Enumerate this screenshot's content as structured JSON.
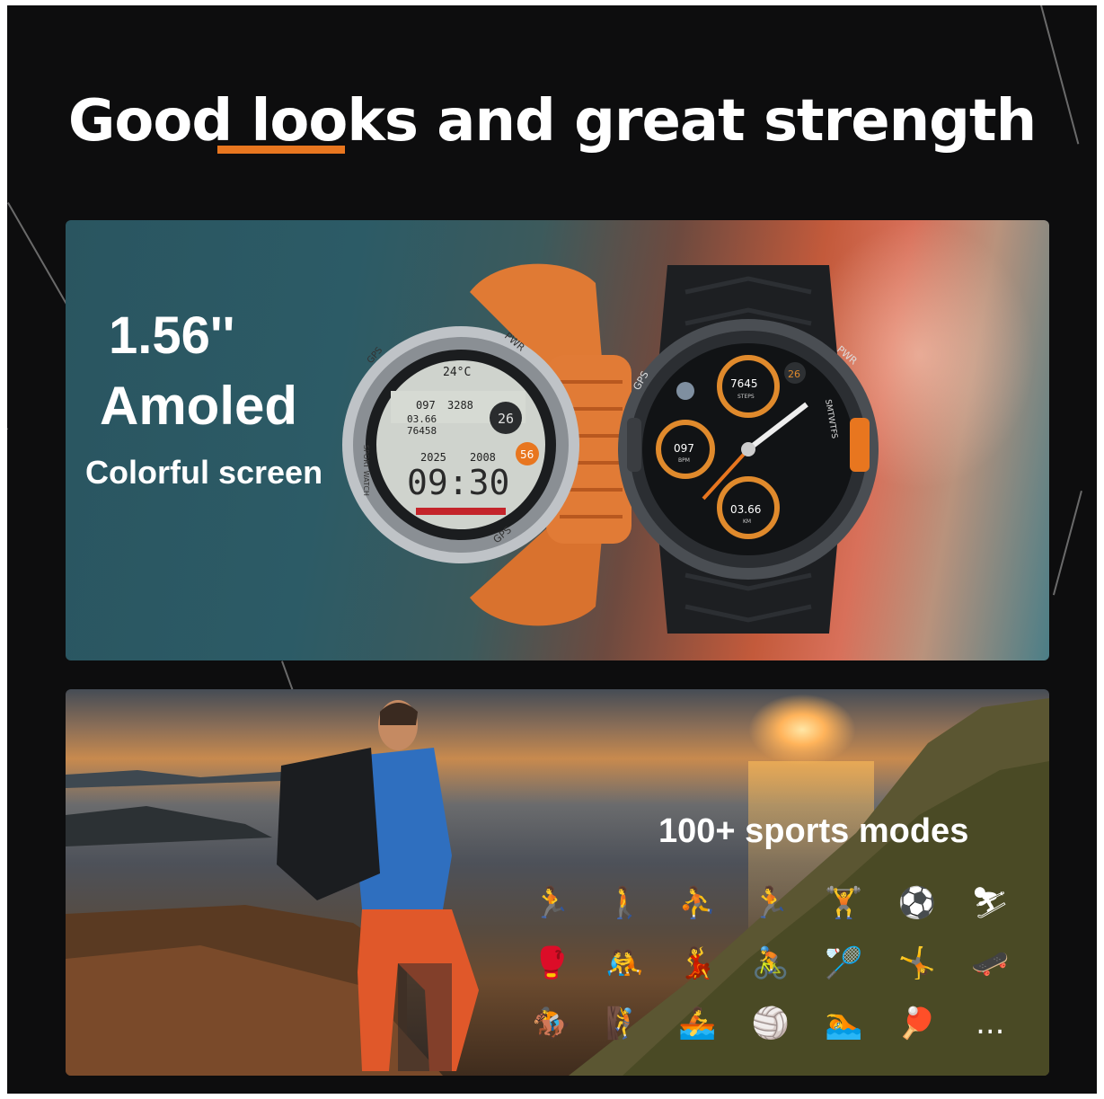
{
  "headline": "Good looks and great strength",
  "display_panel": {
    "size": "1.56''",
    "type": "Amoled",
    "subtitle": "Colorful screen",
    "watch1": {
      "temp": "24°C",
      "hr": "097",
      "cal": "3288",
      "dist": "03.66",
      "steps": "76458",
      "day": "26",
      "year": "2025",
      "date": "2008",
      "time": "09:30",
      "badge": "56",
      "bezel_labels": [
        "GPS",
        "PWR",
        "GPS",
        "SPORT WATCH"
      ]
    },
    "watch2": {
      "steps": "7645",
      "steps_label": "STEPS",
      "hr": "097",
      "hr_label": "BPM",
      "dist": "03.66",
      "dist_label": "KM",
      "day": "26",
      "weekdays": "SMTWTFS",
      "bezel_labels": [
        "GPS",
        "PWR"
      ]
    }
  },
  "sports_panel": {
    "title": "100+ sports modes",
    "icons": [
      "running-icon",
      "hiking-icon",
      "basketball-icon",
      "treadmill-icon",
      "weightlifting-icon",
      "football-icon",
      "skiing-icon",
      "boxing-icon",
      "wrestling-icon",
      "dancing-icon",
      "cycling-icon",
      "badminton-icon",
      "gymnastics-icon",
      "skateboard-icon",
      "horse-riding-icon",
      "climbing-icon",
      "rowing-icon",
      "volleyball-icon",
      "swimming-icon",
      "table-tennis-icon",
      "more-icon"
    ],
    "more": "..."
  },
  "colors": {
    "accent": "#e8761f",
    "background": "#0d0d0e"
  }
}
